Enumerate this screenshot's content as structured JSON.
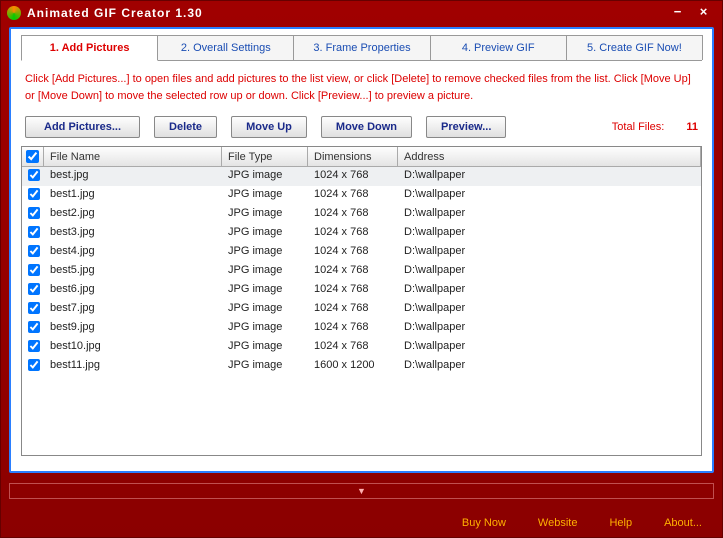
{
  "title": "Animated GIF Creator 1.30",
  "tabs": [
    {
      "label": "1. Add Pictures",
      "active": true
    },
    {
      "label": "2. Overall Settings",
      "active": false
    },
    {
      "label": "3. Frame Properties",
      "active": false
    },
    {
      "label": "4. Preview GIF",
      "active": false
    },
    {
      "label": "5. Create GIF Now!",
      "active": false
    }
  ],
  "instructions": "Click [Add Pictures...] to open files and add pictures to the list view, or click [Delete] to remove checked files from the list. Click [Move Up] or [Move Down] to move the selected row up or down. Click [Preview...] to preview a picture.",
  "buttons": {
    "add": "Add Pictures...",
    "delete": "Delete",
    "moveup": "Move Up",
    "movedown": "Move Down",
    "preview": "Preview..."
  },
  "total_label": "Total Files:",
  "total_count": "11",
  "columns": {
    "name": "File Name",
    "type": "File Type",
    "dim": "Dimensions",
    "addr": "Address"
  },
  "rows": [
    {
      "name": "best.jpg",
      "type": "JPG image",
      "dim": "1024 x 768",
      "addr": "D:\\wallpaper"
    },
    {
      "name": "best1.jpg",
      "type": "JPG image",
      "dim": "1024 x 768",
      "addr": "D:\\wallpaper"
    },
    {
      "name": "best2.jpg",
      "type": "JPG image",
      "dim": "1024 x 768",
      "addr": "D:\\wallpaper"
    },
    {
      "name": "best3.jpg",
      "type": "JPG image",
      "dim": "1024 x 768",
      "addr": "D:\\wallpaper"
    },
    {
      "name": "best4.jpg",
      "type": "JPG image",
      "dim": "1024 x 768",
      "addr": "D:\\wallpaper"
    },
    {
      "name": "best5.jpg",
      "type": "JPG image",
      "dim": "1024 x 768",
      "addr": "D:\\wallpaper"
    },
    {
      "name": "best6.jpg",
      "type": "JPG image",
      "dim": "1024 x 768",
      "addr": "D:\\wallpaper"
    },
    {
      "name": "best7.jpg",
      "type": "JPG image",
      "dim": "1024 x 768",
      "addr": "D:\\wallpaper"
    },
    {
      "name": "best9.jpg",
      "type": "JPG image",
      "dim": "1024 x 768",
      "addr": "D:\\wallpaper"
    },
    {
      "name": "best10.jpg",
      "type": "JPG image",
      "dim": "1024 x 768",
      "addr": "D:\\wallpaper"
    },
    {
      "name": "best11.jpg",
      "type": "JPG image",
      "dim": "1600 x 1200",
      "addr": "D:\\wallpaper"
    }
  ],
  "footer": {
    "buy": "Buy Now",
    "site": "Website",
    "help": "Help",
    "about": "About..."
  },
  "expand_glyph": "▼"
}
